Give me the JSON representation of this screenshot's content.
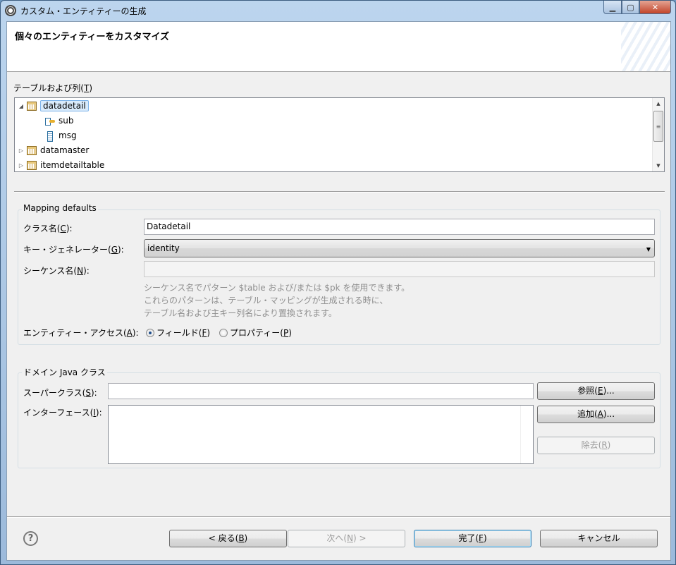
{
  "window": {
    "title": "カスタム・エンティティーの生成",
    "minimize_label": "▁",
    "maximize_label": "▢",
    "close_label": "✕"
  },
  "header": {
    "title": "個々のエンティティーをカスタマイズ"
  },
  "tables_section": {
    "label": "テーブルおよび列(",
    "mnemonic": "T",
    "label_end": ")",
    "tree": [
      {
        "name": "datadetail",
        "expanded": true,
        "selected": true,
        "icon": "table-icon",
        "children": [
          {
            "name": "sub",
            "icon": "primary-key-column-icon"
          },
          {
            "name": "msg",
            "icon": "column-icon"
          }
        ]
      },
      {
        "name": "datamaster",
        "expanded": false,
        "icon": "table-icon"
      },
      {
        "name": "itemdetailtable",
        "expanded": false,
        "icon": "table-icon"
      }
    ]
  },
  "mapping": {
    "group_title": "Mapping defaults",
    "class_name": {
      "label": "クラス名(",
      "mnemonic": "C",
      "label_end": "):",
      "value": "Datadetail"
    },
    "key_generator": {
      "label": "キー・ジェネレーター(",
      "mnemonic": "G",
      "label_end": "):",
      "value": "identity"
    },
    "sequence_name": {
      "label": "シーケンス名(",
      "mnemonic": "N",
      "label_end": "):",
      "value": ""
    },
    "hint_lines": [
      "シーケンス名でパターン $table および/または $pk を使用できます。",
      "これらのパターンは、テーブル・マッピングが生成される時に、",
      "テーブル名および主キー列名により置換されます。"
    ],
    "access": {
      "label": "エンティティー・アクセス(",
      "mnemonic": "A",
      "label_end": "):",
      "field": {
        "label": "フィールド(",
        "mnemonic": "F",
        "label_end": ")",
        "selected": true
      },
      "property": {
        "label": "プロパティー(",
        "mnemonic": "P",
        "label_end": ")",
        "selected": false
      }
    }
  },
  "domain": {
    "group_title": "ドメイン Java クラス",
    "superclass": {
      "label": "スーパークラス(",
      "mnemonic": "S",
      "label_end": "):",
      "value": ""
    },
    "interfaces": {
      "label": "インターフェース(",
      "mnemonic": "I",
      "label_end": "):"
    },
    "browse": {
      "label": "参照(",
      "mnemonic": "E",
      "label_end": ")..."
    },
    "add": {
      "label": "追加(",
      "mnemonic": "A",
      "label_end": ")..."
    },
    "remove": {
      "label": "除去(",
      "mnemonic": "R",
      "label_end": ")"
    }
  },
  "footer": {
    "help": "?",
    "back": {
      "label": "< 戻る(",
      "mnemonic": "B",
      "label_end": ")"
    },
    "next": {
      "label": "次へ(",
      "mnemonic": "N",
      "label_end": ") >"
    },
    "finish": {
      "label": "完了(",
      "mnemonic": "F",
      "label_end": ")"
    },
    "cancel": {
      "label": "キャンセル"
    }
  }
}
